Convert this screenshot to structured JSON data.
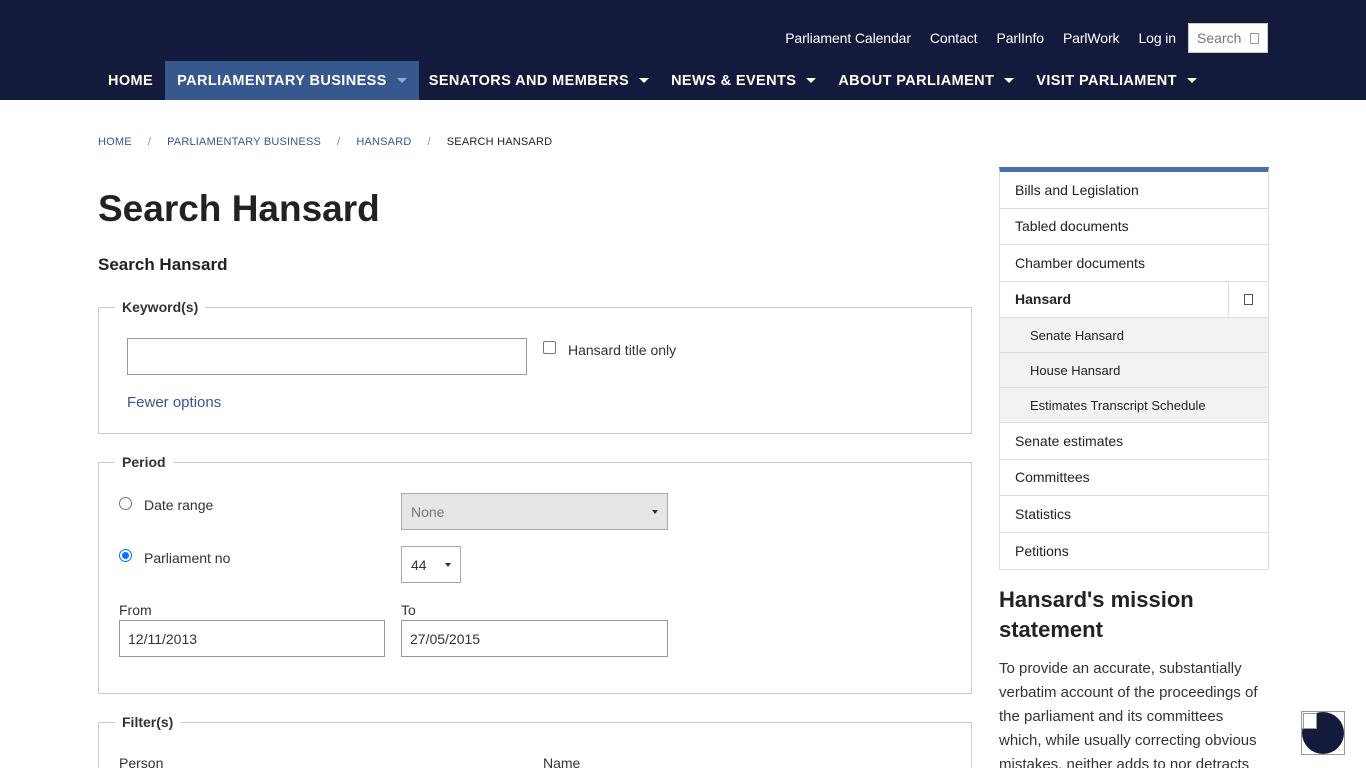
{
  "utility_nav": {
    "links": [
      "Parliament Calendar",
      "Contact",
      "ParlInfo",
      "ParlWork",
      "Log in"
    ],
    "search_label": "Search"
  },
  "main_nav": {
    "items": [
      {
        "label": "HOME"
      },
      {
        "label": "PARLIAMENTARY BUSINESS"
      },
      {
        "label": "SENATORS AND MEMBERS"
      },
      {
        "label": "NEWS & EVENTS"
      },
      {
        "label": "ABOUT PARLIAMENT"
      },
      {
        "label": "VISIT PARLIAMENT"
      }
    ],
    "active": "PARLIAMENTARY BUSINESS"
  },
  "breadcrumb": {
    "items": [
      "HOME",
      "PARLIAMENTARY BUSINESS",
      "HANSARD",
      "SEARCH HANSARD"
    ],
    "separator": "/"
  },
  "page": {
    "title": "Search Hansard",
    "subtitle": "Search Hansard"
  },
  "keywords": {
    "legend": "Keyword(s)",
    "value": "",
    "title_only_label": "Hansard title only",
    "title_only_checked": false,
    "fewer_options": "Fewer options"
  },
  "period": {
    "legend": "Period",
    "date_range_label": "Date range",
    "date_range_value": "None",
    "parliament_no_label": "Parliament no",
    "parliament_no_value": "44",
    "selected": "parliament_no",
    "from_label": "From",
    "from_value": "12/11/2013",
    "to_label": "To",
    "to_value": "27/05/2015"
  },
  "filters": {
    "legend": "Filter(s)",
    "person_label": "Person",
    "name_label": "Name"
  },
  "side_nav": {
    "items": [
      {
        "label": "Bills and Legislation"
      },
      {
        "label": "Tabled documents"
      },
      {
        "label": "Chamber documents"
      },
      {
        "label": "Hansard"
      },
      {
        "label": "Senate Hansard"
      },
      {
        "label": "House Hansard"
      },
      {
        "label": "Estimates Transcript Schedule"
      },
      {
        "label": "Senate estimates"
      },
      {
        "label": "Committees"
      },
      {
        "label": "Statistics"
      },
      {
        "label": "Petitions"
      }
    ]
  },
  "mission": {
    "title": "Hansard's mission statement",
    "text": "To provide an accurate, substantially verbatim account of the proceedings of the parliament and its committees which, while usually correcting obvious mistakes, neither adds to nor detracts"
  },
  "colors": {
    "header_bg": "#141a3c",
    "nav_active_bg": "#36588f",
    "link": "#36588f",
    "sidenav_accent": "#4a6fb0"
  }
}
